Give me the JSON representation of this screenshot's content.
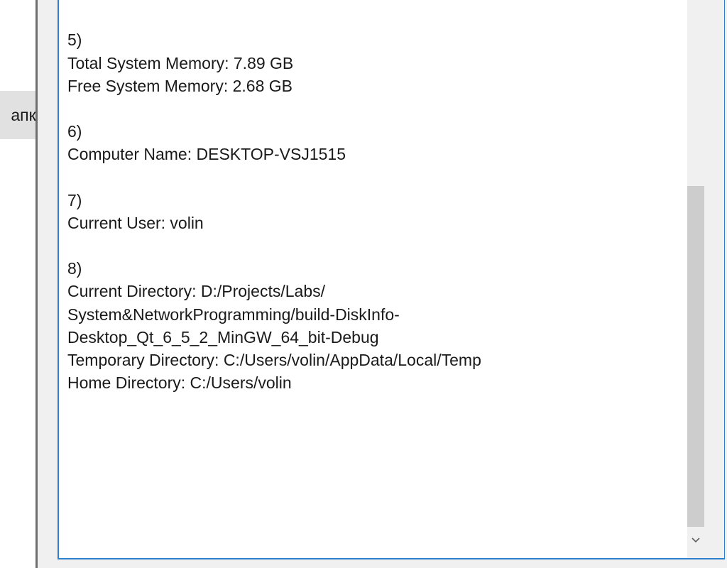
{
  "left_panel": {
    "button_label": "апка"
  },
  "text_area": {
    "lines": [
      "/",
      "",
      "5)",
      "Total System Memory: 7.89 GB",
      "Free System Memory: 2.68 GB",
      "",
      "6)",
      "Computer Name: DESKTOP-VSJ1515",
      "",
      "7)",
      "Current User: volin",
      "",
      "8)",
      "Current Directory: D:/Projects/Labs/",
      "System&NetworkProgramming/build-DiskInfo-",
      "Desktop_Qt_6_5_2_MinGW_64_bit-Debug",
      "Temporary Directory: C:/Users/volin/AppData/Local/Temp",
      "Home Directory: C:/Users/volin"
    ]
  },
  "scrollbar": {
    "down_arrow_icon": "chevron-down-icon"
  }
}
